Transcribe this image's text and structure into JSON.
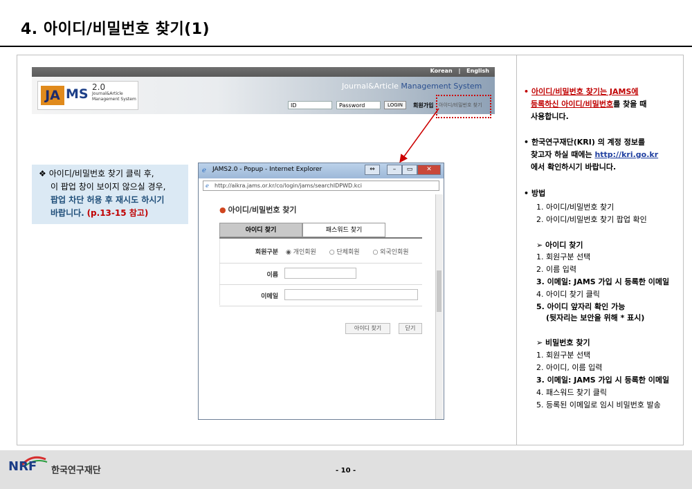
{
  "title": "4. 아이디/비밀번호 찾기(1)",
  "jams": {
    "lang_korean": "Korean",
    "lang_sep": "|",
    "lang_english": "English",
    "logo_ja": "JA",
    "logo_ms": "MS",
    "logo_version": "2.0",
    "logo_sub1": "Journal&Article",
    "logo_sub2": "Management System",
    "brand_a": "Journal&Article",
    "brand_b": "Management System",
    "id_placeholder": "ID",
    "password_placeholder": "Password",
    "login_label": "LOGIN",
    "join_label": "회원가입",
    "find_label": "아이디/비밀번호 찾기"
  },
  "callout": {
    "bullet": "❖",
    "line1": "아이디/비밀번호 찾기 클릭 후,",
    "line2": "이 팝업 창이 보이지 않으실 경우,",
    "line3": "팝업 차단 허용 후 재시도 하시기",
    "line4a": "바랍니다.",
    "line4b": "(p.13-15 참고)"
  },
  "popup": {
    "window_title": "JAMS2.0 - Popup - Internet Explorer",
    "address": "http://aikra.jams.or.kr/co/login/jams/searchIDPWD.kci",
    "heading": "아이디/비밀번호 찾기",
    "tab_id": "아이디 찾기",
    "tab_pw": "패스워드 찾기",
    "member_type_label": "회원구분",
    "member_types": [
      "개인회원",
      "단체회원",
      "외국인회원"
    ],
    "name_label": "이름",
    "email_label": "이메일",
    "find_id_button": "아이디 찾기",
    "close_button": "닫기"
  },
  "right": {
    "b1_red": "아이디/비밀번호 찾기는 JAMS에",
    "b1_red2": "등록하신 아이디/비밀번호",
    "b1_tail": "를 찾을 때",
    "b1_line3": "사용합니다.",
    "b2_line1": "한국연구재단(KRI) 의 계정 정보를",
    "b2_line2a": "찾고자 하실 때에는 ",
    "b2_link": "http://kri.go.kr",
    "b2_line3": "에서 확인하시기 바랍니다.",
    "method_label": "방법",
    "method_steps": [
      "1. 아이디/비밀번호 찾기",
      "2. 아이디/비밀번호 찾기 팝업 확인"
    ],
    "id_find_head": "➢  아이디 찾기",
    "id_steps": [
      "1. 회원구분 선택",
      "2. 이름 입력",
      "3. 이메일: JAMS 가입 시 등록한 이메일",
      "4. 아이디 찾기 클릭",
      "5. 아이디 앞자리 확인 가능",
      "(뒷자리는 보안을 위해 * 표시)"
    ],
    "pw_find_head": "➢  비밀번호 찾기",
    "pw_steps": [
      "1. 회원구분 선택",
      "2. 아이디, 이름 입력",
      "3. 이메일: JAMS 가입 시 등록한 이메일",
      "4. 패스워드 찾기 클릭",
      "5. 등록된 이메일로 임시 비밀번호 발송"
    ]
  },
  "footer": {
    "nrf": "NRF",
    "org": "한국연구재단",
    "page": "- 10 -"
  },
  "colors": {
    "accent_red": "#c00000",
    "link_blue": "#1f3fa0",
    "callout_bg": "#dbe9f4"
  }
}
